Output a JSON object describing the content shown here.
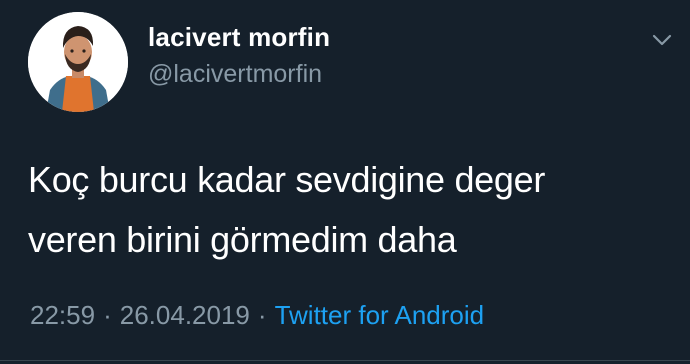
{
  "tweet": {
    "author": {
      "display_name": "lacivert morfin",
      "handle": "@lacivertmorfin"
    },
    "text_lines": [
      "Koç burcu kadar sevdigine deger",
      "veren birini görmedim daha"
    ],
    "time": "22:59",
    "separator": "·",
    "date": "26.04.2019",
    "source": "Twitter for Android"
  },
  "icons": {
    "menu": "chevron-down-icon",
    "avatar": "avatar"
  },
  "colors": {
    "background": "#15202b",
    "primary_text": "#ffffff",
    "secondary_text": "#8899a6",
    "link": "#1da1f2"
  }
}
